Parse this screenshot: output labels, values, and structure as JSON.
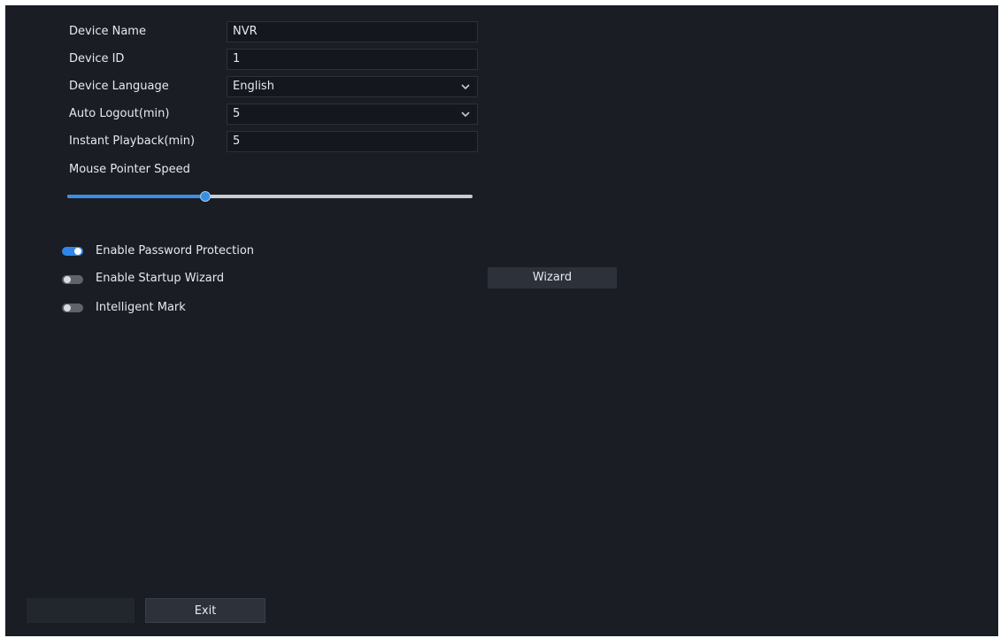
{
  "form": {
    "device_name_label": "Device Name",
    "device_name_value": "NVR",
    "device_id_label": "Device ID",
    "device_id_value": "1",
    "device_language_label": "Device Language",
    "device_language_value": "English",
    "auto_logout_label": "Auto Logout(min)",
    "auto_logout_value": "5",
    "instant_playback_label": "Instant Playback(min)",
    "instant_playback_value": "5",
    "mouse_pointer_speed_label": "Mouse Pointer Speed",
    "mouse_pointer_speed_level": 0.34
  },
  "toggles": [
    {
      "label": "Enable Password Protection",
      "on": true
    },
    {
      "label": "Enable Startup Wizard",
      "on": false
    },
    {
      "label": "Intelligent Mark",
      "on": false
    }
  ],
  "wizard_button_label": "Wizard",
  "footer": {
    "exit_label": "Exit"
  },
  "colors": {
    "background": "#1a1d24",
    "accent": "#2f86ea",
    "toggle_off": "#5f646c"
  },
  "icons": {
    "dropdown": "chevron-down-icon"
  }
}
